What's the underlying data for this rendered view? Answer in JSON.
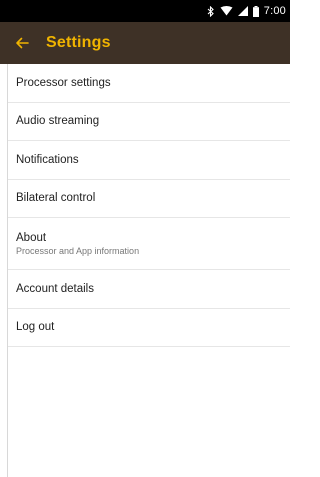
{
  "status_bar": {
    "time": "7:00",
    "icons": [
      "bluetooth-icon",
      "wifi-icon",
      "cell-signal-icon",
      "battery-icon"
    ]
  },
  "app_bar": {
    "title": "Settings",
    "back_icon": "arrow-left-icon",
    "background": "#3e3126",
    "accent": "#f0b400"
  },
  "settings": {
    "items": [
      {
        "label": "Processor settings"
      },
      {
        "label": "Audio streaming"
      },
      {
        "label": "Notifications"
      },
      {
        "label": "Bilateral control"
      },
      {
        "label": "About",
        "sublabel": "Processor and App information"
      },
      {
        "label": "Account details"
      },
      {
        "label": "Log out"
      }
    ]
  }
}
